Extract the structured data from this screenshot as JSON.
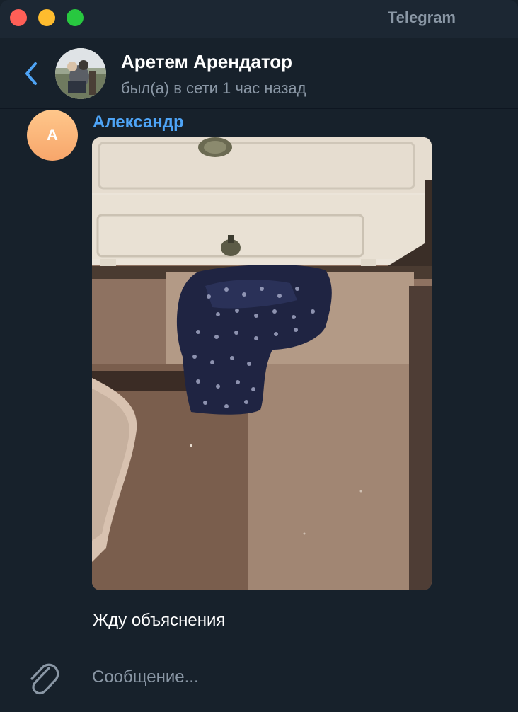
{
  "window": {
    "app_title": "Telegram"
  },
  "header": {
    "contact_name": "Аретем Арендатор",
    "status": "был(а) в сети 1 час назад",
    "back_icon": "chevron-left-icon"
  },
  "message": {
    "sender_initial": "A",
    "sender_name": "Александр",
    "photo_description_icon": "photo-attachment",
    "text": "Жду объяснения"
  },
  "composer": {
    "placeholder": "Сообщение...",
    "attach_icon": "paperclip-icon"
  },
  "colors": {
    "background": "#17212b",
    "accent": "#4ea4f6",
    "muted_text": "#8a97a5",
    "avatar_gradient_top": "#ffc78b",
    "avatar_gradient_bottom": "#f7a66b"
  }
}
